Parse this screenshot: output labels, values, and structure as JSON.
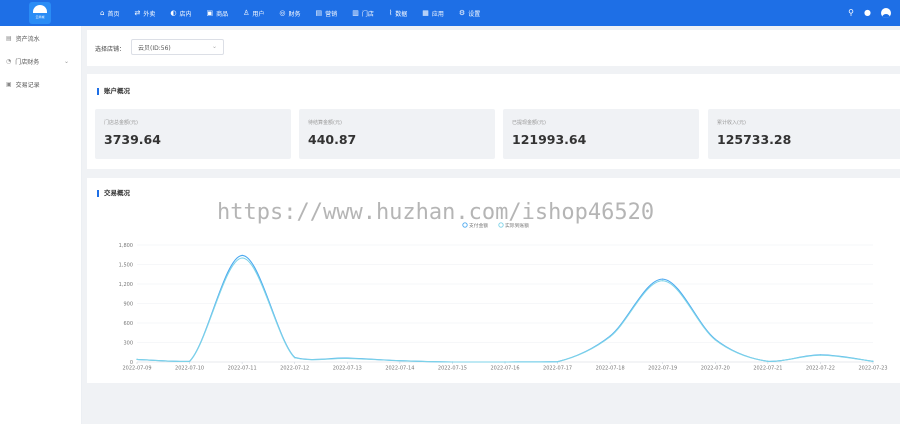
{
  "app": {
    "logo_text": "云商城"
  },
  "nav": [
    {
      "label": "首页",
      "icon": "home-icon",
      "glyph": "⌂"
    },
    {
      "label": "外卖",
      "icon": "takeout-icon",
      "glyph": "⇄"
    },
    {
      "label": "店内",
      "icon": "dine-in-icon",
      "glyph": "◐"
    },
    {
      "label": "商品",
      "icon": "goods-icon",
      "glyph": "▣"
    },
    {
      "label": "用户",
      "icon": "user-icon",
      "glyph": "♙"
    },
    {
      "label": "财务",
      "icon": "finance-icon",
      "glyph": "◎"
    },
    {
      "label": "营销",
      "icon": "marketing-icon",
      "glyph": "▤"
    },
    {
      "label": "门店",
      "icon": "store-icon",
      "glyph": "▥"
    },
    {
      "label": "数据",
      "icon": "data-icon",
      "glyph": "⌇"
    },
    {
      "label": "应用",
      "icon": "apps-icon",
      "glyph": "▦"
    },
    {
      "label": "设置",
      "icon": "settings-icon",
      "glyph": "⚙"
    }
  ],
  "topbar_right": {
    "search_icon": "search-icon",
    "bell_icon": "bell-icon",
    "avatar_icon": "avatar-icon"
  },
  "sidebar": [
    {
      "label": "资产流水",
      "icon": "ledger-icon",
      "glyph": "▤",
      "expandable": false
    },
    {
      "label": "门店财务",
      "icon": "store-finance-icon",
      "glyph": "◔",
      "expandable": true
    },
    {
      "label": "交易记录",
      "icon": "record-icon",
      "glyph": "▣",
      "expandable": false
    }
  ],
  "filter": {
    "label": "选择店铺：",
    "selected": "云贝(ID:56)"
  },
  "accounts": {
    "title": "账户概况",
    "cards": [
      {
        "label": "门店总金额(元)",
        "value": "3739.64"
      },
      {
        "label": "待结算金额(元)",
        "value": "440.87"
      },
      {
        "label": "已提现金额(元)",
        "value": "121993.64"
      },
      {
        "label": "累计收入(元)",
        "value": "125733.28"
      }
    ]
  },
  "chart_section": {
    "title": "交易概况"
  },
  "chart_data": {
    "type": "line",
    "categories": [
      "2022-07-09",
      "2022-07-10",
      "2022-07-11",
      "2022-07-12",
      "2022-07-13",
      "2022-07-14",
      "2022-07-15",
      "2022-07-16",
      "2022-07-17",
      "2022-07-18",
      "2022-07-19",
      "2022-07-20",
      "2022-07-21",
      "2022-07-22",
      "2022-07-23"
    ],
    "y_ticks": [
      "0",
      "300",
      "600",
      "900",
      "1,200",
      "1,500",
      "1,800"
    ],
    "ylim": [
      0,
      1800
    ],
    "grid": true,
    "legend_position": "top-center",
    "legend": [
      "支付金额",
      "实际到账额"
    ],
    "series": [
      {
        "name": "支付金额",
        "color": "#4aa8f0",
        "values": [
          40,
          10,
          1640,
          70,
          60,
          20,
          0,
          0,
          5,
          400,
          1275,
          350,
          10,
          110,
          10
        ]
      },
      {
        "name": "实际到账额",
        "color": "#7dd3e8",
        "values": [
          40,
          10,
          1600,
          65,
          55,
          20,
          0,
          0,
          5,
          390,
          1250,
          340,
          10,
          105,
          10
        ]
      }
    ]
  },
  "watermark": "https://www.huzhan.com/ishop46520"
}
